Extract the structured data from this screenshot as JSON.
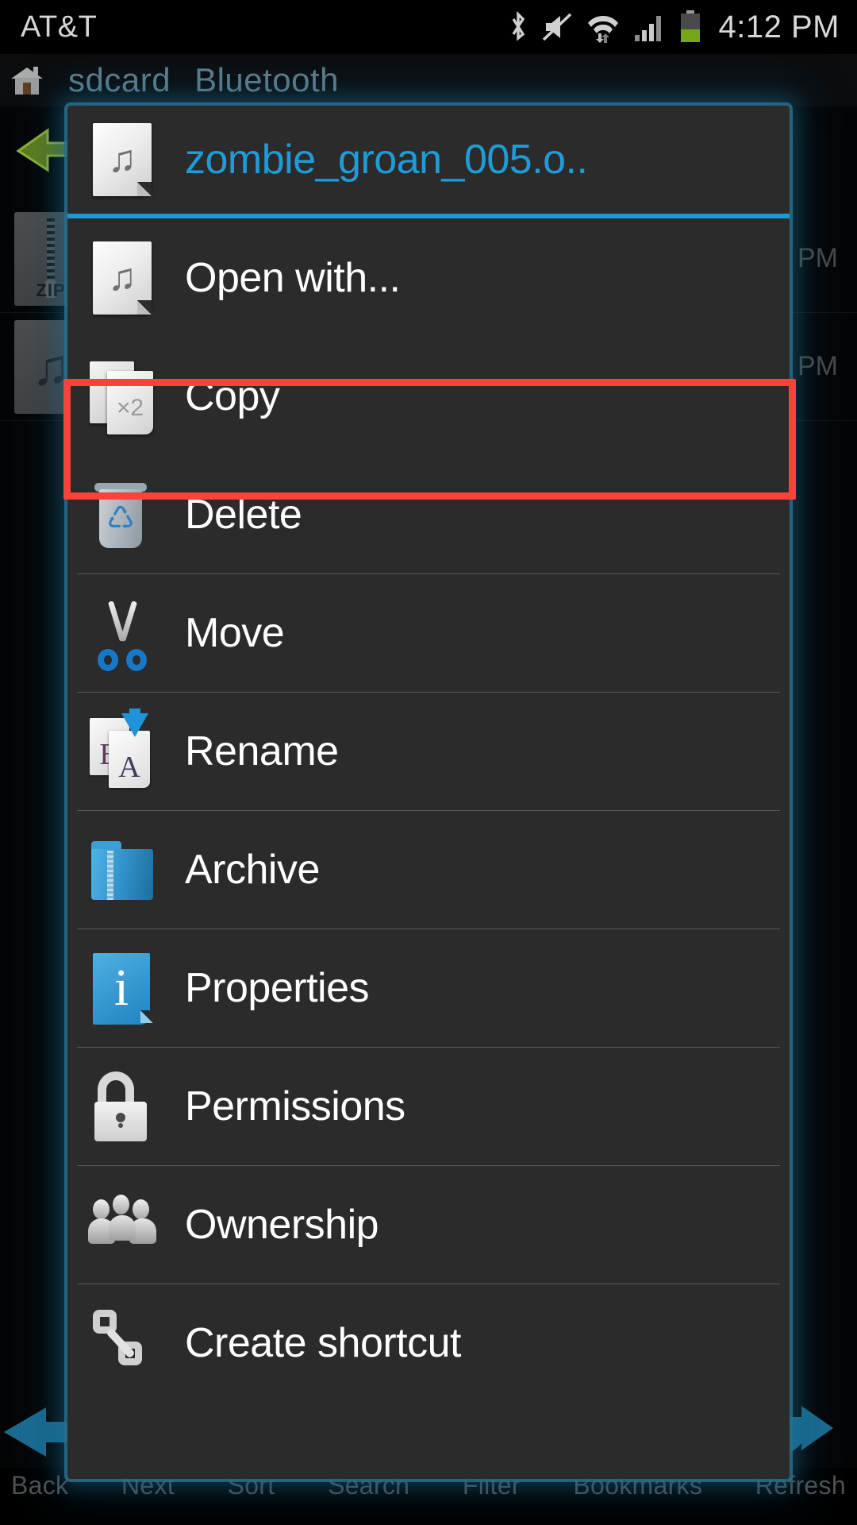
{
  "status_bar": {
    "carrier": "AT&T",
    "time": "4:12 PM",
    "icons": [
      "bluetooth-icon",
      "mute-icon",
      "wifi-icon",
      "signal-icon",
      "battery-icon"
    ]
  },
  "background": {
    "breadcrumbs": [
      "sdcard",
      "Bluetooth"
    ],
    "home_icon": "home-icon",
    "back_arrow_icon": "green-back-arrow-icon",
    "files": [
      {
        "icon": "zip-file-icon",
        "label": "ZIP",
        "time": "PM"
      },
      {
        "icon": "music-file-icon",
        "label": "",
        "time": "PM"
      }
    ],
    "toolbar": [
      {
        "label": "Back"
      },
      {
        "label": "Next"
      },
      {
        "label": "Sort"
      },
      {
        "label": "Search"
      },
      {
        "label": "Filter"
      },
      {
        "label": "Bookmarks"
      },
      {
        "label": "Refresh"
      }
    ]
  },
  "dialog": {
    "title": "zombie_groan_005.o..",
    "title_icon": "music-file-icon",
    "title_color": "#1f9cd8",
    "border_color": "#286e8c",
    "items": [
      {
        "label": "Open with...",
        "icon": "music-file-icon"
      },
      {
        "label": "Copy",
        "icon": "copy-x2-icon"
      },
      {
        "label": "Delete",
        "icon": "trash-can-icon"
      },
      {
        "label": "Move",
        "icon": "scissors-icon"
      },
      {
        "label": "Rename",
        "icon": "rename-ba-icon"
      },
      {
        "label": "Archive",
        "icon": "archive-folder-icon"
      },
      {
        "label": "Properties",
        "icon": "info-icon"
      },
      {
        "label": "Permissions",
        "icon": "padlock-icon"
      },
      {
        "label": "Ownership",
        "icon": "people-icon"
      },
      {
        "label": "Create shortcut",
        "icon": "chain-link-icon"
      }
    ]
  },
  "highlight": {
    "target": "Copy",
    "color": "#f9423a"
  }
}
